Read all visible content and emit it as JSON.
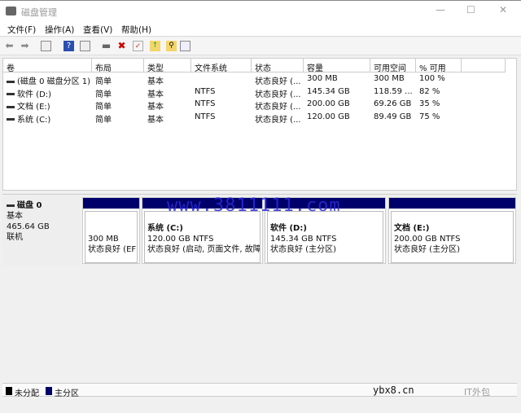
{
  "window": {
    "title": "磁盘管理",
    "minimize": "—",
    "maximize": "☐",
    "close": "✕"
  },
  "menu": [
    "文件(F)",
    "操作(A)",
    "查看(V)",
    "帮助(H)"
  ],
  "toolbar": [
    "back-icon",
    "forward-icon",
    "console-tree-icon",
    "help-icon",
    "properties-view-icon",
    "connect-disk-icon",
    "delete-icon",
    "check-icon",
    "folder-up-icon",
    "folder-search-icon",
    "settings-icon"
  ],
  "table": {
    "headers": [
      "卷",
      "布局",
      "类型",
      "文件系统",
      "状态",
      "容量",
      "可用空间",
      "% 可用"
    ],
    "rows": [
      [
        "(磁盘 0 磁盘分区 1)",
        "简单",
        "基本",
        "",
        "状态良好 (...",
        "300 MB",
        "300 MB",
        "100 %"
      ],
      [
        "软件 (D:)",
        "简单",
        "基本",
        "NTFS",
        "状态良好 (...",
        "145.34 GB",
        "118.59 ...",
        "82 %"
      ],
      [
        "文档 (E:)",
        "简单",
        "基本",
        "NTFS",
        "状态良好 (...",
        "200.00 GB",
        "69.26 GB",
        "35 %"
      ],
      [
        "系统 (C:)",
        "简单",
        "基本",
        "NTFS",
        "状态良好 (...",
        "120.00 GB",
        "89.49 GB",
        "75 %"
      ]
    ]
  },
  "disk": {
    "name": "磁盘 0",
    "type": "基本",
    "size": "465.64 GB",
    "status": "联机",
    "partitions": [
      {
        "name": "",
        "size": "300 MB",
        "status": "状态良好 (EFI"
      },
      {
        "name": "系统 (C:)",
        "size": "120.00 GB NTFS",
        "status": "状态良好 (启动, 页面文件, 故障"
      },
      {
        "name": "软件 (D:)",
        "size": "145.34 GB NTFS",
        "status": "状态良好 (主分区)"
      },
      {
        "name": "文档 (E:)",
        "size": "200.00 GB NTFS",
        "status": "状态良好 (主分区)"
      }
    ]
  },
  "legend": [
    {
      "label": "未分配",
      "color": "#000000"
    },
    {
      "label": "主分区",
      "color": "#00006a"
    }
  ],
  "watermarks": [
    "www.3811111.com",
    "ybx8.cn",
    "IT外包"
  ],
  "colors": {
    "primary_partition": "#00006a",
    "unallocated": "#000000"
  }
}
